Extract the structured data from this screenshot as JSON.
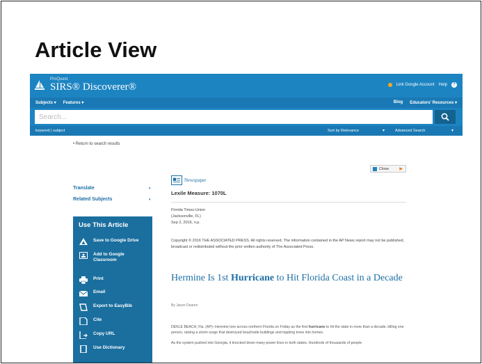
{
  "slide": {
    "title": "Article View"
  },
  "app": {
    "brand_small": "ProQuest",
    "brand": "SIRS® Discoverer®",
    "link_google": "Link Google Account",
    "help": "Help",
    "help_symbol": "?"
  },
  "nav": {
    "left": [
      "Subjects ▾",
      "Features ▾"
    ],
    "right": [
      "Blog",
      "Educators' Resources ▾"
    ]
  },
  "search": {
    "placeholder": "Search..."
  },
  "subbar": {
    "keyword": "keyword  |  subject",
    "sort": "Sort by Relevance",
    "advanced": "Advanced Search",
    "arrow": "▾"
  },
  "back_link": "• Return to search results",
  "close_button": {
    "label": "Close",
    "arrow": "▶"
  },
  "left_links": [
    {
      "label": "Translate",
      "arrow": "▾"
    },
    {
      "label": "Related Subjects",
      "arrow": "▾"
    }
  ],
  "use_panel": {
    "title": "Use This Article",
    "items": [
      {
        "label": "Save to Google Drive",
        "icon": "google-drive-icon"
      },
      {
        "label": "Add to Google Classroom",
        "icon": "google-classroom-icon"
      },
      {
        "label": "Print",
        "icon": "print-icon"
      },
      {
        "label": "Email",
        "icon": "email-icon"
      },
      {
        "label": "Export to EasyBib",
        "icon": "easybib-icon"
      },
      {
        "label": "Cite",
        "icon": "cite-icon"
      },
      {
        "label": "Copy URL",
        "icon": "copy-url-icon"
      },
      {
        "label": "Use Dictionary",
        "icon": "dictionary-icon"
      }
    ]
  },
  "article": {
    "type": "Newspaper",
    "lexile": "Lexile Measure: 1070L",
    "source": [
      "Florida Times-Union",
      "(Jacksonville, FL)",
      "Sep 2, 2016, n.p."
    ],
    "copyright": "Copyright © 2016 THE ASSOCIATED PRESS. All rights reserved. The information contained in the AP News report may not be published, broadcast or redistributed without the prior written authority of The Associated Press.",
    "headline_pre": "Hermine Is 1st ",
    "headline_bold": "Hurricane",
    "headline_post": " to Hit Florida Coast in a Decade",
    "byline": "By Jason Dearen",
    "p1_pre": "DEKLE BEACH, Fla. (AP)--Hermine tore across northern Florida on Friday as the first ",
    "p1_bold": "hurricane",
    "p1_post": " to hit the state in more than a decade, killing one person, raising a storm surge that destroyed beachside buildings and toppling trees into homes.",
    "p2": "As the system pushed into Georgia, it knocked down many power lines in both states. Hundreds of thousands of people"
  },
  "colors": {
    "header": "#1d84c2",
    "panel": "#1a6f9f",
    "link": "#1d6fa5"
  }
}
